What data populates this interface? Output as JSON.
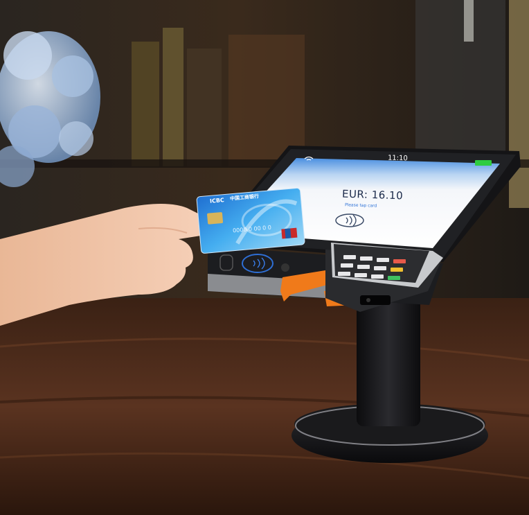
{
  "terminal": {
    "status_time": "11:10",
    "amount": "EUR: 16.10",
    "prompt": "Please tap card"
  },
  "card": {
    "bank_abbrev": "ICBC",
    "bank_name": "中国工商银行",
    "number_fragment": "0000 0 00 0 0"
  },
  "colors": {
    "wood": "#4a2a16",
    "device_body": "#1c1d20",
    "accent": "#f07a1a",
    "screen_top": "#4a90e2"
  }
}
